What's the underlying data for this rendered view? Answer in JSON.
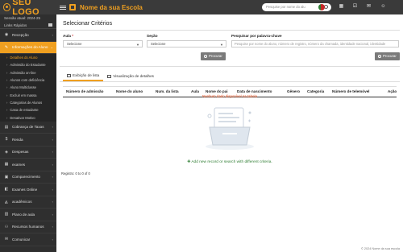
{
  "sidebar": {
    "logo": "SEU LOGO",
    "session": "Sessão atual: 2024-25",
    "quick_links": "Links Rápidos",
    "menu_top": [
      {
        "label": "Recepção",
        "icon": "reception-icon"
      }
    ],
    "active_menu": {
      "label": "Informações do Aluno",
      "icon": "student-icon"
    },
    "submenu": [
      "Detalhes do Aluno",
      "Admissão do Estudante",
      "Admissão on-line",
      "Alunos com deficiência",
      "Aluno Multiclasse",
      "Excluir em massa",
      "Categorias de Alunos",
      "Casa de estudante",
      "Desativar Motivo"
    ],
    "menu_bottom": [
      {
        "label": "Cobrança de Taxas",
        "icon": "fees-icon"
      },
      {
        "label": "Renda",
        "icon": "income-icon"
      },
      {
        "label": "Despesas",
        "icon": "expense-icon"
      },
      {
        "label": "exames",
        "icon": "exam-icon"
      },
      {
        "label": "Comparecimento",
        "icon": "attendance-icon"
      },
      {
        "label": "Exames Online",
        "icon": "online-exam-icon"
      },
      {
        "label": "acadêmicos",
        "icon": "academic-icon"
      },
      {
        "label": "Plano de aula",
        "icon": "lesson-plan-icon"
      },
      {
        "label": "Recursos humanos",
        "icon": "hr-icon"
      },
      {
        "label": "Comunicar",
        "icon": "communicate-icon"
      }
    ]
  },
  "topbar": {
    "school_name": "Nome da sua Escola",
    "search_placeholder": "Pesquise por nome do alu",
    "currency": "USD"
  },
  "main": {
    "title": "Selecionar Critérios",
    "class_label": "Aula",
    "class_value": "Selecione",
    "section_label": "Seção",
    "section_value": "Selecione",
    "keyword_label": "Pesquisar por palavra-chave",
    "keyword_placeholder": "Pesquise por nome do aluno, número de registro, número da chamada, identidade nacional, identidade",
    "search_button": "Procurar",
    "tab_list": "Exibição de lista",
    "tab_details": "Visualização de detalhes",
    "columns": [
      "Número de admissão",
      "Nome do aluno",
      "Num. da lista",
      "Aula",
      "Nome do pai",
      "Data de nascimento",
      "Gênero",
      "Categoria",
      "Número de telemóvel",
      "Ação"
    ],
    "no_data": "Nenhum dado disponível na tabela",
    "add_new": "Add new record or search with different criteria.",
    "records": "Registro: 0 to 0 of 0"
  },
  "footer": "© 2024 Nome da sua escola",
  "colors": {
    "accent": "#f0a020",
    "sidebar": "#2f2f2f",
    "topbar": "#3a3a3a"
  }
}
